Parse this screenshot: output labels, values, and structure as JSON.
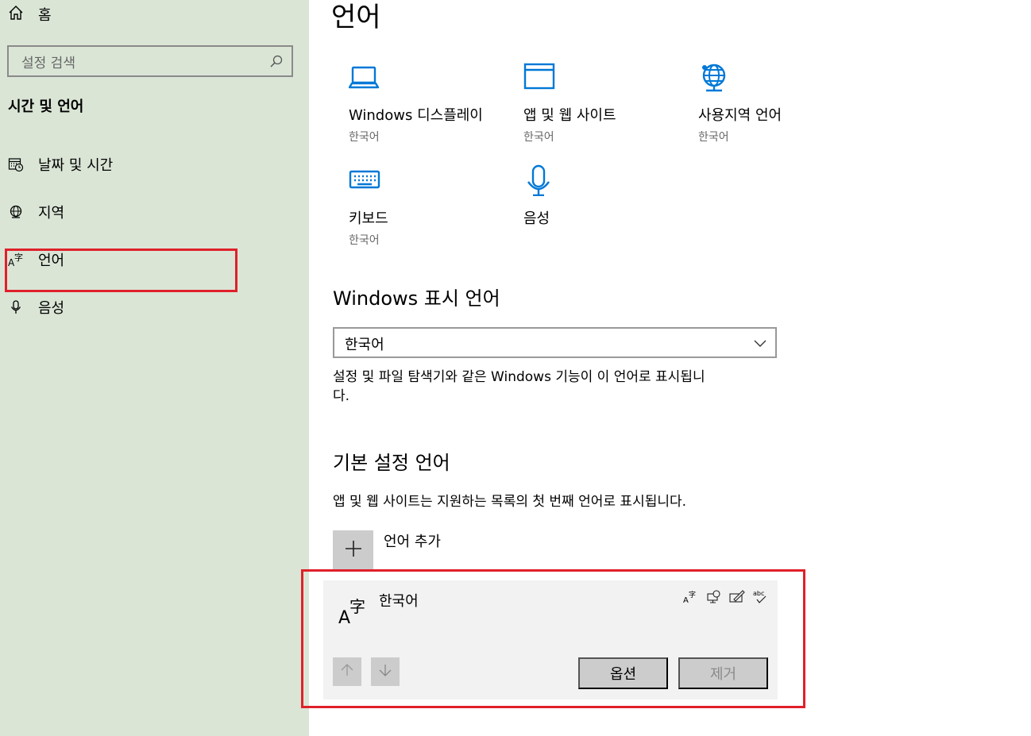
{
  "sidebar": {
    "home_label": "홈",
    "search_placeholder": "설정 검색",
    "section_title": "시간 및 언어",
    "items": [
      {
        "label": "날짜 및 시간",
        "icon": "calendar-clock-icon"
      },
      {
        "label": "지역",
        "icon": "globe-icon"
      },
      {
        "label": "언어",
        "icon": "language-icon"
      },
      {
        "label": "음성",
        "icon": "microphone-icon"
      }
    ]
  },
  "main": {
    "title": "언어",
    "tiles": [
      {
        "label": "Windows 디스플레이",
        "sub": "한국어",
        "icon": "laptop-icon"
      },
      {
        "label": "앱 및 웹 사이트",
        "sub": "한국어",
        "icon": "window-icon"
      },
      {
        "label": "사용지역 언어",
        "sub": "한국어",
        "icon": "globe-icon"
      },
      {
        "label": "키보드",
        "sub": "한국어",
        "icon": "keyboard-icon"
      },
      {
        "label": "음성",
        "sub": "",
        "icon": "microphone-icon"
      }
    ],
    "display_language": {
      "heading": "Windows 표시 언어",
      "selected": "한국어",
      "description_line1": "설정 및 파일 탐색기와 같은 Windows 기능이 이 언어로 표시됩니",
      "description_line2": "다."
    },
    "preferred_languages": {
      "heading": "기본 설정 언어",
      "description": "앱 및 웹 사이트는 지원하는 목록의 첫 번째 언어로 표시됩니다.",
      "add_label": "언어 추가",
      "languages": [
        {
          "name": "한국어",
          "options_label": "옵션",
          "remove_label": "제거"
        }
      ]
    }
  },
  "colors": {
    "sidebar_bg": "#dae5d6",
    "accent": "#0078d7",
    "highlight": "#e0202a"
  }
}
